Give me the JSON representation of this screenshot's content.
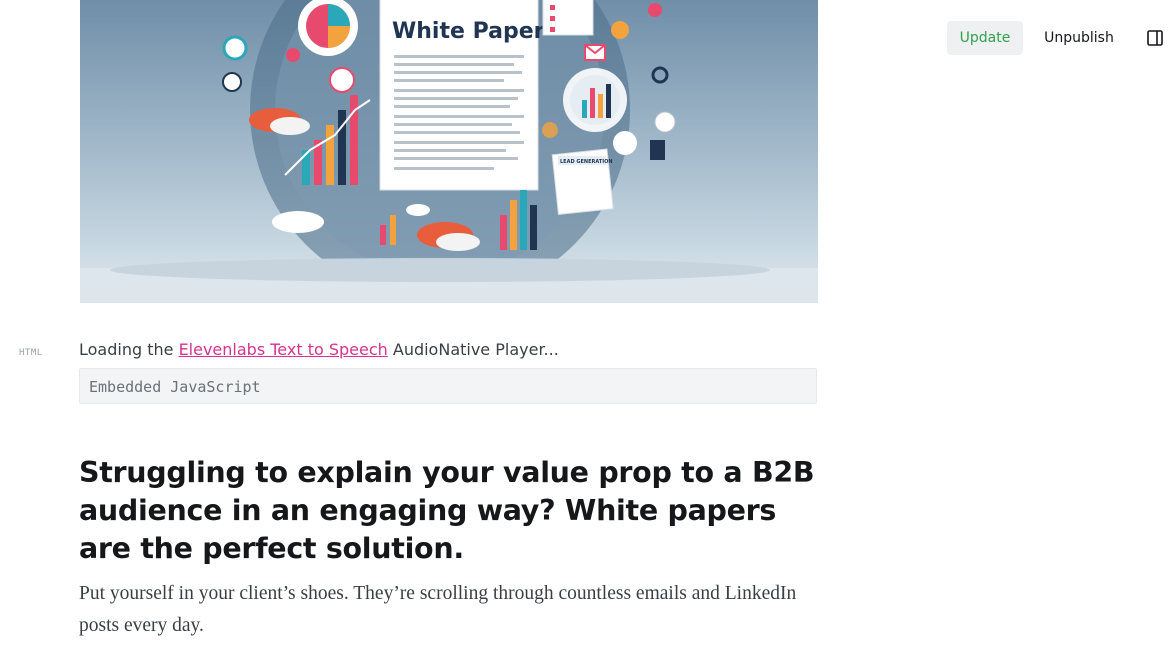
{
  "toolbar": {
    "update_label": "Update",
    "unpublish_label": "Unpublish",
    "sidebar_toggle_icon": "sidebar-panel-icon"
  },
  "hero_image": {
    "title_text": "White Paper",
    "badge_text": "LEAD GENERATION"
  },
  "html_card": {
    "tag": "HTML",
    "loading_prefix": "Loading the ",
    "link_text": "Elevenlabs Text to Speech",
    "loading_suffix": " AudioNative Player...",
    "code_placeholder": "Embedded JavaScript"
  },
  "article": {
    "heading": "Struggling to explain your value prop to a B2B audience in an engaging way? White papers are the perfect solution.",
    "paragraph": "Put yourself in your client’s shoes. They’re scrolling through countless emails and LinkedIn posts every day."
  },
  "colors": {
    "accent_green": "#30a14e",
    "link_pink": "#d6338f"
  }
}
